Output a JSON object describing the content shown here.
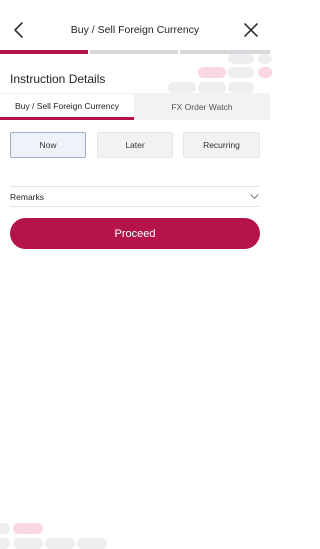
{
  "header": {
    "title": "Buy / Sell Foreign Currency",
    "back_icon": "chevron-left-icon",
    "close_icon": "close-icon"
  },
  "progress": {
    "current_step": 1,
    "total_steps": 3,
    "active_color": "#b5144a"
  },
  "section": {
    "title": "Instruction Details"
  },
  "tabs": [
    {
      "label": "Buy / Sell Foreign Currency",
      "active": true
    },
    {
      "label": "FX Order Watch",
      "active": false
    }
  ],
  "timing": {
    "options": [
      "Now",
      "Later",
      "Recurring"
    ],
    "selected": "Now"
  },
  "remarks": {
    "label": "Remarks",
    "icon": "chevron-down-icon"
  },
  "actions": {
    "proceed_label": "Proceed"
  },
  "colors": {
    "brand": "#b5144a",
    "accent_light": "#fbd7e1"
  }
}
